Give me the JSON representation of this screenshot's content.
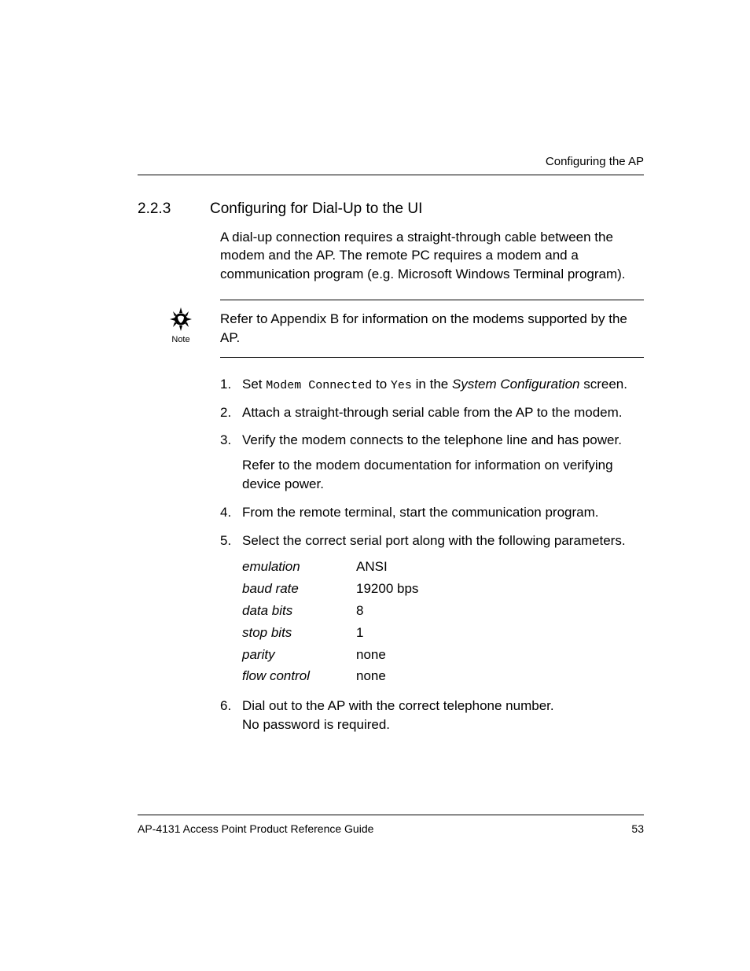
{
  "header": {
    "running": "Configuring the AP"
  },
  "section": {
    "number": "2.2.3",
    "title": "Configuring for Dial-Up to the UI",
    "intro": "A dial-up connection requires a straight-through cable between the modem and the AP. The remote PC requires a modem and a communication program (e.g. Microsoft Windows Terminal program)."
  },
  "note": {
    "label": "Note",
    "text": "Refer to Appendix B for information on the modems supported by the AP."
  },
  "steps": {
    "s1": {
      "num": "1.",
      "pre": "Set ",
      "code1": "Modem Connected",
      "mid": " to ",
      "code2": "Yes",
      "post1": " in the ",
      "ital": "System Configuration",
      "post2": " screen."
    },
    "s2": {
      "num": "2.",
      "text": "Attach a straight-through serial cable from the AP to the modem."
    },
    "s3": {
      "num": "3.",
      "text": "Verify the modem connects to the telephone line and has power.",
      "sub": "Refer to the modem documentation for information on verifying device power."
    },
    "s4": {
      "num": "4.",
      "text": "From the remote terminal, start the communication program."
    },
    "s5": {
      "num": "5.",
      "text": "Select the correct serial port along with the following parameters.",
      "params": {
        "r0": {
          "k": "emulation",
          "v": "ANSI"
        },
        "r1": {
          "k": "baud rate",
          "v": "19200 bps"
        },
        "r2": {
          "k": "data bits",
          "v": "8"
        },
        "r3": {
          "k": "stop bits",
          "v": "1"
        },
        "r4": {
          "k": "parity",
          "v": "none"
        },
        "r5": {
          "k": "flow control",
          "v": "none"
        }
      }
    },
    "s6": {
      "num": "6.",
      "line1": "Dial out to the AP with the correct telephone number.",
      "line2": "No password is required."
    }
  },
  "footer": {
    "title": "AP-4131 Access Point Product Reference Guide",
    "page": "53"
  }
}
